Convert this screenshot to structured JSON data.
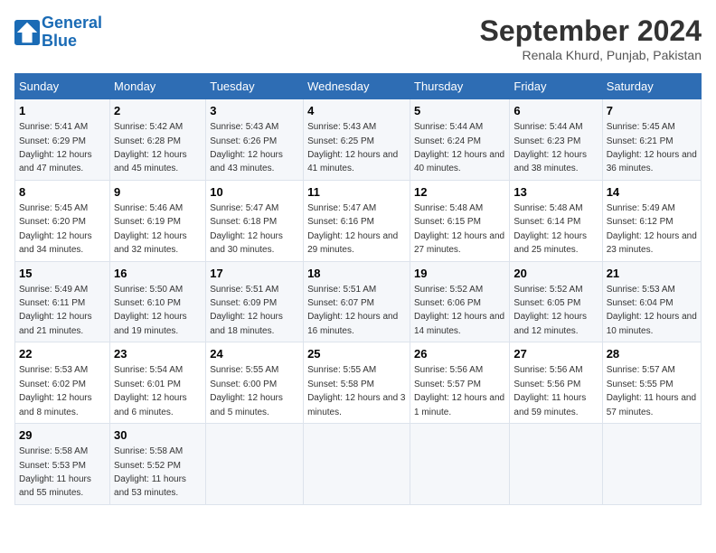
{
  "logo": {
    "line1": "General",
    "line2": "Blue"
  },
  "title": "September 2024",
  "subtitle": "Renala Khurd, Punjab, Pakistan",
  "days_of_week": [
    "Sunday",
    "Monday",
    "Tuesday",
    "Wednesday",
    "Thursday",
    "Friday",
    "Saturday"
  ],
  "weeks": [
    [
      {
        "day": "1",
        "sunrise": "Sunrise: 5:41 AM",
        "sunset": "Sunset: 6:29 PM",
        "daylight": "Daylight: 12 hours and 47 minutes."
      },
      {
        "day": "2",
        "sunrise": "Sunrise: 5:42 AM",
        "sunset": "Sunset: 6:28 PM",
        "daylight": "Daylight: 12 hours and 45 minutes."
      },
      {
        "day": "3",
        "sunrise": "Sunrise: 5:43 AM",
        "sunset": "Sunset: 6:26 PM",
        "daylight": "Daylight: 12 hours and 43 minutes."
      },
      {
        "day": "4",
        "sunrise": "Sunrise: 5:43 AM",
        "sunset": "Sunset: 6:25 PM",
        "daylight": "Daylight: 12 hours and 41 minutes."
      },
      {
        "day": "5",
        "sunrise": "Sunrise: 5:44 AM",
        "sunset": "Sunset: 6:24 PM",
        "daylight": "Daylight: 12 hours and 40 minutes."
      },
      {
        "day": "6",
        "sunrise": "Sunrise: 5:44 AM",
        "sunset": "Sunset: 6:23 PM",
        "daylight": "Daylight: 12 hours and 38 minutes."
      },
      {
        "day": "7",
        "sunrise": "Sunrise: 5:45 AM",
        "sunset": "Sunset: 6:21 PM",
        "daylight": "Daylight: 12 hours and 36 minutes."
      }
    ],
    [
      {
        "day": "8",
        "sunrise": "Sunrise: 5:45 AM",
        "sunset": "Sunset: 6:20 PM",
        "daylight": "Daylight: 12 hours and 34 minutes."
      },
      {
        "day": "9",
        "sunrise": "Sunrise: 5:46 AM",
        "sunset": "Sunset: 6:19 PM",
        "daylight": "Daylight: 12 hours and 32 minutes."
      },
      {
        "day": "10",
        "sunrise": "Sunrise: 5:47 AM",
        "sunset": "Sunset: 6:18 PM",
        "daylight": "Daylight: 12 hours and 30 minutes."
      },
      {
        "day": "11",
        "sunrise": "Sunrise: 5:47 AM",
        "sunset": "Sunset: 6:16 PM",
        "daylight": "Daylight: 12 hours and 29 minutes."
      },
      {
        "day": "12",
        "sunrise": "Sunrise: 5:48 AM",
        "sunset": "Sunset: 6:15 PM",
        "daylight": "Daylight: 12 hours and 27 minutes."
      },
      {
        "day": "13",
        "sunrise": "Sunrise: 5:48 AM",
        "sunset": "Sunset: 6:14 PM",
        "daylight": "Daylight: 12 hours and 25 minutes."
      },
      {
        "day": "14",
        "sunrise": "Sunrise: 5:49 AM",
        "sunset": "Sunset: 6:12 PM",
        "daylight": "Daylight: 12 hours and 23 minutes."
      }
    ],
    [
      {
        "day": "15",
        "sunrise": "Sunrise: 5:49 AM",
        "sunset": "Sunset: 6:11 PM",
        "daylight": "Daylight: 12 hours and 21 minutes."
      },
      {
        "day": "16",
        "sunrise": "Sunrise: 5:50 AM",
        "sunset": "Sunset: 6:10 PM",
        "daylight": "Daylight: 12 hours and 19 minutes."
      },
      {
        "day": "17",
        "sunrise": "Sunrise: 5:51 AM",
        "sunset": "Sunset: 6:09 PM",
        "daylight": "Daylight: 12 hours and 18 minutes."
      },
      {
        "day": "18",
        "sunrise": "Sunrise: 5:51 AM",
        "sunset": "Sunset: 6:07 PM",
        "daylight": "Daylight: 12 hours and 16 minutes."
      },
      {
        "day": "19",
        "sunrise": "Sunrise: 5:52 AM",
        "sunset": "Sunset: 6:06 PM",
        "daylight": "Daylight: 12 hours and 14 minutes."
      },
      {
        "day": "20",
        "sunrise": "Sunrise: 5:52 AM",
        "sunset": "Sunset: 6:05 PM",
        "daylight": "Daylight: 12 hours and 12 minutes."
      },
      {
        "day": "21",
        "sunrise": "Sunrise: 5:53 AM",
        "sunset": "Sunset: 6:04 PM",
        "daylight": "Daylight: 12 hours and 10 minutes."
      }
    ],
    [
      {
        "day": "22",
        "sunrise": "Sunrise: 5:53 AM",
        "sunset": "Sunset: 6:02 PM",
        "daylight": "Daylight: 12 hours and 8 minutes."
      },
      {
        "day": "23",
        "sunrise": "Sunrise: 5:54 AM",
        "sunset": "Sunset: 6:01 PM",
        "daylight": "Daylight: 12 hours and 6 minutes."
      },
      {
        "day": "24",
        "sunrise": "Sunrise: 5:55 AM",
        "sunset": "Sunset: 6:00 PM",
        "daylight": "Daylight: 12 hours and 5 minutes."
      },
      {
        "day": "25",
        "sunrise": "Sunrise: 5:55 AM",
        "sunset": "Sunset: 5:58 PM",
        "daylight": "Daylight: 12 hours and 3 minutes."
      },
      {
        "day": "26",
        "sunrise": "Sunrise: 5:56 AM",
        "sunset": "Sunset: 5:57 PM",
        "daylight": "Daylight: 12 hours and 1 minute."
      },
      {
        "day": "27",
        "sunrise": "Sunrise: 5:56 AM",
        "sunset": "Sunset: 5:56 PM",
        "daylight": "Daylight: 11 hours and 59 minutes."
      },
      {
        "day": "28",
        "sunrise": "Sunrise: 5:57 AM",
        "sunset": "Sunset: 5:55 PM",
        "daylight": "Daylight: 11 hours and 57 minutes."
      }
    ],
    [
      {
        "day": "29",
        "sunrise": "Sunrise: 5:58 AM",
        "sunset": "Sunset: 5:53 PM",
        "daylight": "Daylight: 11 hours and 55 minutes."
      },
      {
        "day": "30",
        "sunrise": "Sunrise: 5:58 AM",
        "sunset": "Sunset: 5:52 PM",
        "daylight": "Daylight: 11 hours and 53 minutes."
      },
      null,
      null,
      null,
      null,
      null
    ]
  ]
}
